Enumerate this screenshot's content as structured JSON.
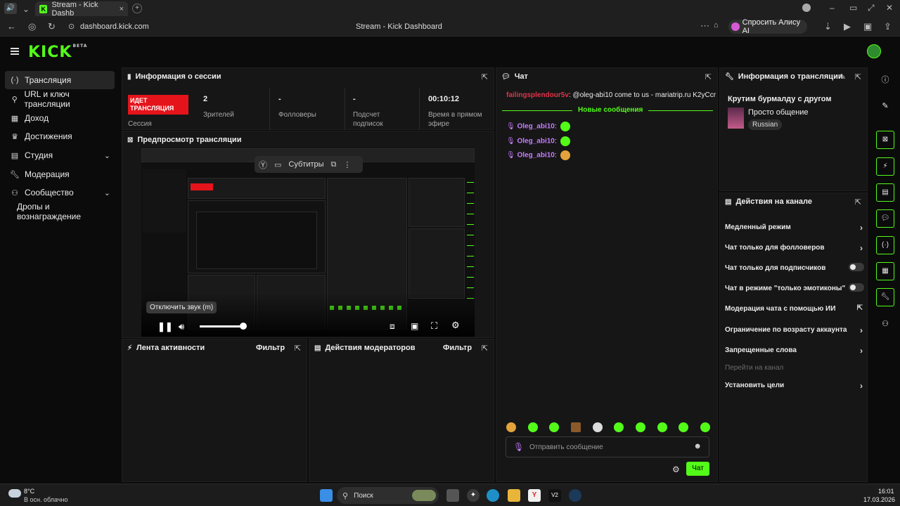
{
  "browser": {
    "tab_title": "Stream - Kick Dashb",
    "address": "dashboard.kick.com",
    "page_title": "Stream - Kick Dashboard",
    "alice_button": "Спросить Алису AI"
  },
  "kick": {
    "logo": "KICK",
    "beta": "BETA"
  },
  "sidebar": {
    "items": [
      {
        "label": "Трансляция",
        "icon": "broadcast-icon"
      },
      {
        "label": "URL и ключ трансляции",
        "icon": "key-icon"
      },
      {
        "label": "Доход",
        "icon": "revenue-icon"
      },
      {
        "label": "Достижения",
        "icon": "trophy-icon"
      },
      {
        "label": "Студия",
        "icon": "studio-icon"
      },
      {
        "label": "Модерация",
        "icon": "wrench-icon"
      },
      {
        "label": "Сообщество",
        "icon": "community-icon"
      },
      {
        "label": "Дропы и вознаграждение",
        "icon": ""
      }
    ]
  },
  "session": {
    "title": "Информация о сессии",
    "live_badge": "ИДЕТ ТРАНСЛЯЦИЯ",
    "session_label": "Сессия",
    "viewers_value": "2",
    "viewers_label": "Зрителей",
    "followers_value": "-",
    "followers_label": "Фолловеры",
    "subs_value": "-",
    "subs_label": "Подсчет подписок",
    "uptime_value": "00:10:12",
    "uptime_label": "Время в прямом эфире"
  },
  "preview": {
    "title": "Предпросмотр трансляции",
    "subtitles": "Субтитры",
    "tooltip": "Отключить звук (m)",
    "volume_level": 1.0
  },
  "activity": {
    "title": "Лента активности",
    "filter": "Фильтр"
  },
  "modactions": {
    "title": "Действия модераторов",
    "filter": "Фильтр"
  },
  "chat": {
    "title": "Чат",
    "first_user": "failingsplendour5v",
    "first_text": ": @oleg-abi10 come to us - mariatrip.ru K2yCcr",
    "new_messages": "Новые сообщения",
    "messages": [
      {
        "user": "Oleg_abi10",
        "sep": ":"
      },
      {
        "user": "Oleg_abi10",
        "sep": ":"
      },
      {
        "user": "Oleg_abi10",
        "sep": ":"
      }
    ],
    "input_placeholder": "Отправить сообщение",
    "send_label": "Чат"
  },
  "stream_info": {
    "title": "Информация о трансляции",
    "stream_title": "Крутим бурмалду с другом",
    "category": "Просто общение",
    "language": "Russian"
  },
  "channel_actions": {
    "title": "Действия на канале",
    "items": [
      {
        "label": "Медленный режим",
        "kind": "arrow"
      },
      {
        "label": "Чат только для фолловеров",
        "kind": "arrow"
      },
      {
        "label": "Чат только для подписчиков",
        "kind": "toggle"
      },
      {
        "label": "Чат в режиме \"только эмотиконы\"",
        "kind": "toggle"
      },
      {
        "label": "Модерация чата с помощью ИИ",
        "kind": "external"
      },
      {
        "label": "Ограничение по возрасту аккаунта",
        "kind": "arrow"
      },
      {
        "label": "Запрещенные слова",
        "kind": "arrow"
      },
      {
        "label": "Перейти на канал",
        "kind": "disabled"
      },
      {
        "label": "Установить цели",
        "kind": "arrow"
      }
    ]
  },
  "taskbar": {
    "temp": "8°C",
    "weather": "В осн. облачно",
    "search": "Поиск",
    "time": "16:01",
    "date": "17.03.2026"
  },
  "colors": {
    "accent": "#53fc18",
    "live": "#e5141b",
    "username": "#c77dff",
    "first_user": "#e0344a"
  }
}
